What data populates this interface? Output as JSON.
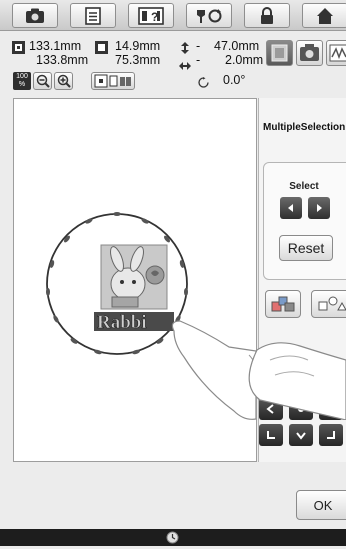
{
  "toolbar": {
    "buttons": [
      {
        "icon": "camera-icon"
      },
      {
        "icon": "document-icon"
      },
      {
        "icon": "help-icon"
      },
      {
        "icon": "needle-thread-icon"
      },
      {
        "icon": "lock-icon"
      },
      {
        "icon": "home-icon"
      }
    ]
  },
  "info": {
    "width_value": "133.1mm",
    "height_value": "133.8mm",
    "size_w": "14.9mm",
    "size_h": "75.3mm",
    "offset_v_sign": "-",
    "offset_v": "47.0mm",
    "offset_h_sign": "-",
    "offset_h": "2.0mm",
    "rotation": "0.0°",
    "zoom_label": "100\n%"
  },
  "canvas": {
    "embroidery_text": "Rabbi"
  },
  "panel": {
    "title": "MultipleSelection",
    "select_label": "Select",
    "reset_label": "Reset"
  },
  "footer": {
    "ok_label": "OK"
  },
  "colors": {
    "accent_dark": "#2f2f2f",
    "canvas_bg": "#ffffff",
    "toolbar_bg": "#d8d8d8"
  }
}
